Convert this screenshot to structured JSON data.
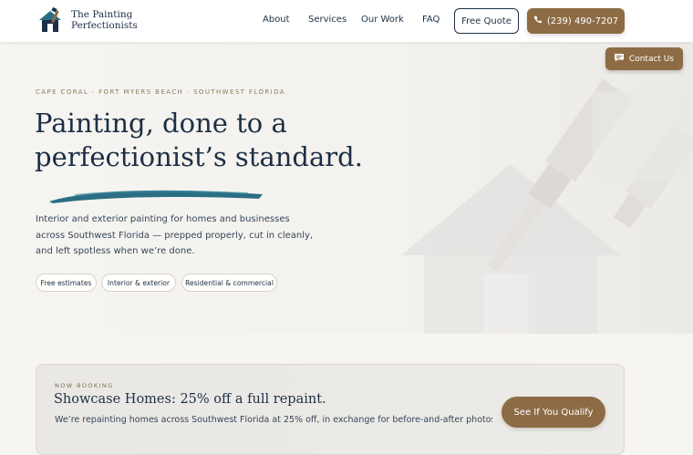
{
  "brand": {
    "name_line1": "The Painting",
    "name_line2": "Perfectionists",
    "logo_icon": "house-paintbrush-logo"
  },
  "nav": {
    "items": [
      {
        "label": "About"
      },
      {
        "label": "Services"
      },
      {
        "label": "Our Work"
      },
      {
        "label": "FAQ"
      }
    ],
    "quote_label": "Free Quote",
    "phone_label": "(239) 490-7207",
    "phone_icon": "phone-icon"
  },
  "contact": {
    "label": "Contact Us",
    "icon": "chat-icon"
  },
  "hero": {
    "eyebrow": "CAPE CORAL · FORT MYERS BEACH · SOUTHWEST FLORIDA",
    "title_line1": "Painting, done to a",
    "title_line2": "perfectionist’s standard.",
    "description": "Interior and exterior painting for homes and businesses across Southwest Florida — prepped properly, cut in cleanly, and left spotless when we’re done.",
    "chips": [
      {
        "label": "Free estimates"
      },
      {
        "label": "Interior & exterior"
      },
      {
        "label": "Residential & commercial"
      }
    ]
  },
  "promo": {
    "eyebrow": "NOW BOOKING",
    "title": "Showcase Homes: 25% off a full repaint.",
    "description": "We’re repainting homes across Southwest Florida at 25% off, in exchange for before-and-after photos",
    "button_label": "See If You Qualify"
  },
  "colors": {
    "navy": "#1d2f45",
    "accent_brown": "#8d6c45",
    "brush_teal": "#2a6e84",
    "background": "#f7f5f1"
  }
}
